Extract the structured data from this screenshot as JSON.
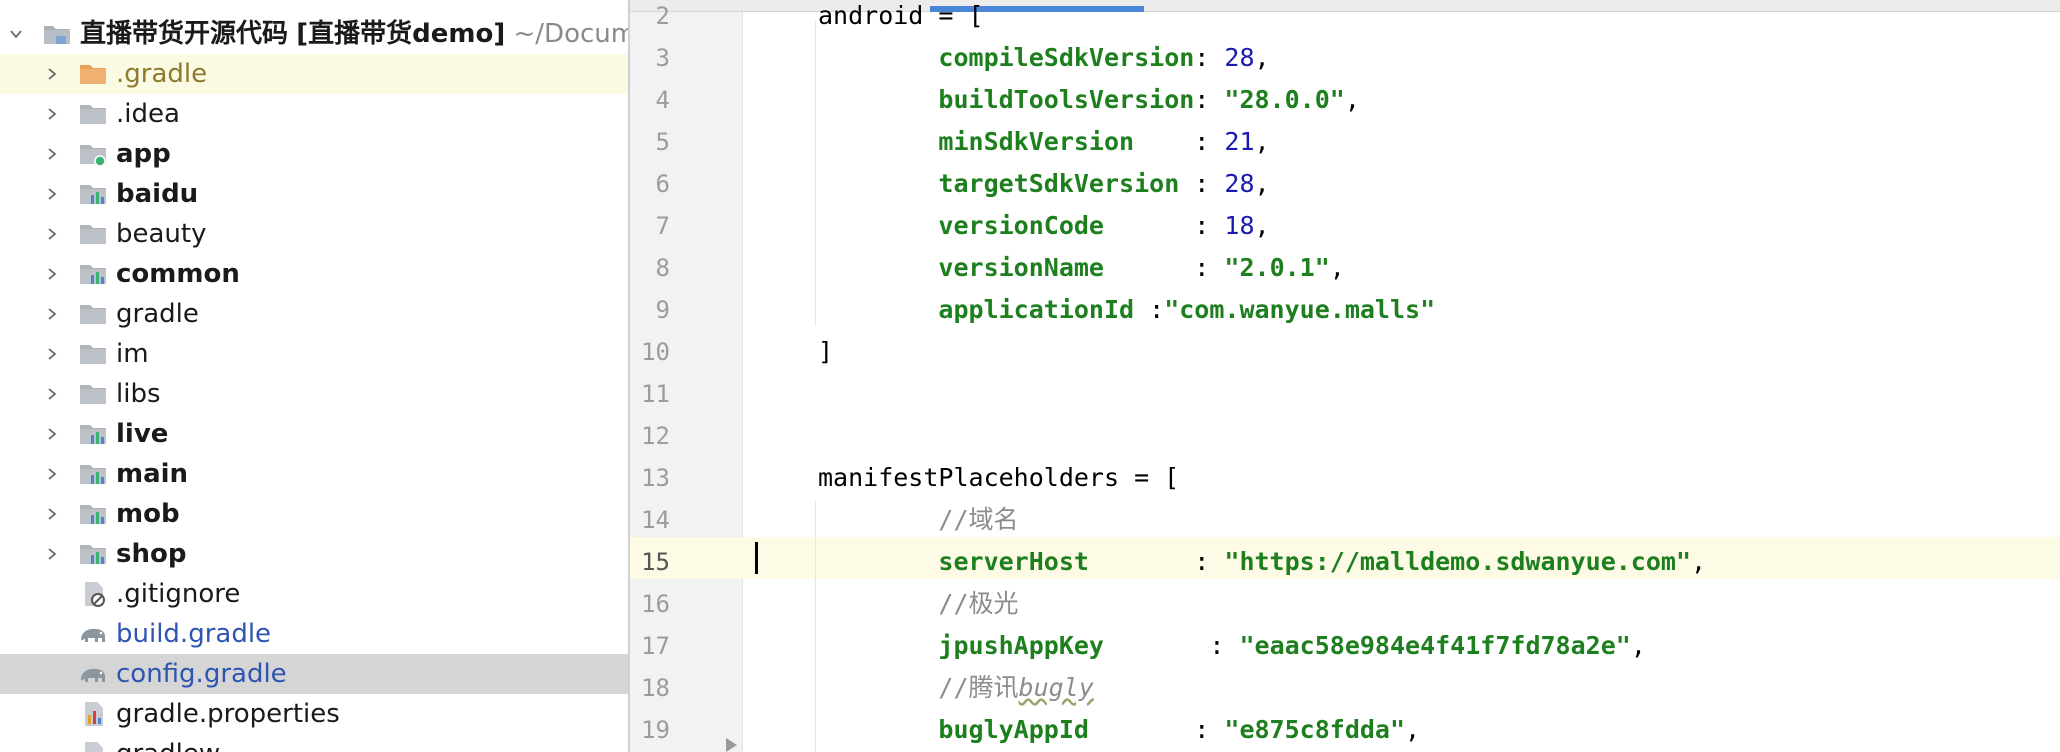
{
  "project": {
    "root_name": "直播带货开源代码",
    "root_module": "[直播带货demo]",
    "root_path": "~/Docum",
    "items": [
      {
        "label": ".gradle",
        "icon": "folder-orange-icon",
        "expandable": true,
        "style": "tan",
        "highlight": "yellow"
      },
      {
        "label": ".idea",
        "icon": "folder-icon",
        "expandable": true,
        "style": "normal",
        "highlight": ""
      },
      {
        "label": "app",
        "icon": "app-module-icon",
        "expandable": true,
        "style": "bold",
        "highlight": ""
      },
      {
        "label": "baidu",
        "icon": "module-folder-icon",
        "expandable": true,
        "style": "bold",
        "highlight": ""
      },
      {
        "label": "beauty",
        "icon": "folder-icon",
        "expandable": true,
        "style": "normal",
        "highlight": ""
      },
      {
        "label": "common",
        "icon": "module-folder-icon",
        "expandable": true,
        "style": "bold",
        "highlight": ""
      },
      {
        "label": "gradle",
        "icon": "folder-icon",
        "expandable": true,
        "style": "normal",
        "highlight": ""
      },
      {
        "label": "im",
        "icon": "folder-icon",
        "expandable": true,
        "style": "normal",
        "highlight": ""
      },
      {
        "label": "libs",
        "icon": "folder-icon",
        "expandable": true,
        "style": "normal",
        "highlight": ""
      },
      {
        "label": "live",
        "icon": "module-folder-icon",
        "expandable": true,
        "style": "bold",
        "highlight": ""
      },
      {
        "label": "main",
        "icon": "module-folder-icon",
        "expandable": true,
        "style": "bold",
        "highlight": ""
      },
      {
        "label": "mob",
        "icon": "module-folder-icon",
        "expandable": true,
        "style": "bold",
        "highlight": ""
      },
      {
        "label": "shop",
        "icon": "module-folder-icon",
        "expandable": true,
        "style": "bold",
        "highlight": ""
      },
      {
        "label": ".gitignore",
        "icon": "gitignore-file-icon",
        "expandable": false,
        "style": "normal",
        "highlight": ""
      },
      {
        "label": "build.gradle",
        "icon": "gradle-elephant-icon",
        "expandable": false,
        "style": "blue",
        "highlight": ""
      },
      {
        "label": "config.gradle",
        "icon": "gradle-elephant-icon",
        "expandable": false,
        "style": "blue",
        "highlight": "grey"
      },
      {
        "label": "gradle.properties",
        "icon": "properties-file-icon",
        "expandable": false,
        "style": "normal",
        "highlight": ""
      },
      {
        "label": "gradlew",
        "icon": "script-file-icon",
        "expandable": false,
        "style": "normal",
        "highlight": ""
      }
    ]
  },
  "editor": {
    "current_line": "15",
    "lines": [
      {
        "num": "2",
        "tokens": [
          {
            "t": "android = [",
            "c": ""
          }
        ]
      },
      {
        "num": "3",
        "tokens": [
          {
            "t": "        ",
            "c": ""
          },
          {
            "t": "compileSdkVersion",
            "c": "k"
          },
          {
            "t": ": ",
            "c": ""
          },
          {
            "t": "28",
            "c": "n"
          },
          {
            "t": ",",
            "c": ""
          }
        ]
      },
      {
        "num": "4",
        "tokens": [
          {
            "t": "        ",
            "c": ""
          },
          {
            "t": "buildToolsVersion",
            "c": "k"
          },
          {
            "t": ": ",
            "c": ""
          },
          {
            "t": "\"28.0.0\"",
            "c": "s"
          },
          {
            "t": ",",
            "c": ""
          }
        ]
      },
      {
        "num": "5",
        "tokens": [
          {
            "t": "        ",
            "c": ""
          },
          {
            "t": "minSdkVersion",
            "c": "k"
          },
          {
            "t": "    : ",
            "c": ""
          },
          {
            "t": "21",
            "c": "n"
          },
          {
            "t": ",",
            "c": ""
          }
        ]
      },
      {
        "num": "6",
        "tokens": [
          {
            "t": "        ",
            "c": ""
          },
          {
            "t": "targetSdkVersion",
            "c": "k"
          },
          {
            "t": " : ",
            "c": ""
          },
          {
            "t": "28",
            "c": "n"
          },
          {
            "t": ",",
            "c": ""
          }
        ]
      },
      {
        "num": "7",
        "tokens": [
          {
            "t": "        ",
            "c": ""
          },
          {
            "t": "versionCode",
            "c": "k"
          },
          {
            "t": "      : ",
            "c": ""
          },
          {
            "t": "18",
            "c": "n"
          },
          {
            "t": ",",
            "c": ""
          }
        ]
      },
      {
        "num": "8",
        "tokens": [
          {
            "t": "        ",
            "c": ""
          },
          {
            "t": "versionName",
            "c": "k"
          },
          {
            "t": "      : ",
            "c": ""
          },
          {
            "t": "\"2.0.1\"",
            "c": "s"
          },
          {
            "t": ",",
            "c": ""
          }
        ]
      },
      {
        "num": "9",
        "tokens": [
          {
            "t": "        ",
            "c": ""
          },
          {
            "t": "applicationId",
            "c": "k"
          },
          {
            "t": " :",
            "c": ""
          },
          {
            "t": "\"com.wanyue.malls\"",
            "c": "s"
          }
        ]
      },
      {
        "num": "10",
        "tokens": [
          {
            "t": "]",
            "c": ""
          }
        ]
      },
      {
        "num": "11",
        "tokens": []
      },
      {
        "num": "12",
        "tokens": []
      },
      {
        "num": "13",
        "tokens": [
          {
            "t": "manifestPlaceholders = [",
            "c": ""
          }
        ]
      },
      {
        "num": "14",
        "tokens": [
          {
            "t": "        ",
            "c": ""
          },
          {
            "t": "//域名",
            "c": "c"
          }
        ]
      },
      {
        "num": "15",
        "tokens": [
          {
            "t": "        ",
            "c": ""
          },
          {
            "t": "serverHost",
            "c": "k"
          },
          {
            "t": "       : ",
            "c": ""
          },
          {
            "t": "\"https://malldemo.sdwanyue.com\"",
            "c": "s"
          },
          {
            "t": ",",
            "c": ""
          }
        ]
      },
      {
        "num": "16",
        "tokens": [
          {
            "t": "        ",
            "c": ""
          },
          {
            "t": "//极光",
            "c": "c"
          }
        ]
      },
      {
        "num": "17",
        "tokens": [
          {
            "t": "        ",
            "c": ""
          },
          {
            "t": "jpushAppKey",
            "c": "k"
          },
          {
            "t": "       : ",
            "c": ""
          },
          {
            "t": "\"eaac58e984e4f41f7fd78a2e\"",
            "c": "s"
          },
          {
            "t": ",",
            "c": ""
          }
        ]
      },
      {
        "num": "18",
        "tokens": [
          {
            "t": "        ",
            "c": ""
          },
          {
            "t": "//腾讯",
            "c": "c"
          },
          {
            "t": "bugly",
            "c": "cu"
          }
        ]
      },
      {
        "num": "19",
        "tokens": [
          {
            "t": "        ",
            "c": ""
          },
          {
            "t": "buglyAppId",
            "c": "k"
          },
          {
            "t": "       : ",
            "c": ""
          },
          {
            "t": "\"e875c8fdda\"",
            "c": "s"
          },
          {
            "t": ",",
            "c": ""
          }
        ]
      }
    ]
  }
}
